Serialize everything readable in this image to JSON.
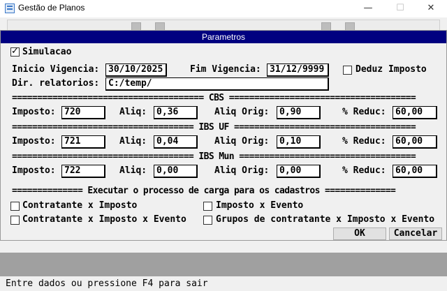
{
  "window": {
    "title": "Gestão de Planos",
    "min_glyph": "—",
    "max_glyph": "☐",
    "close_glyph": "✕"
  },
  "dialog": {
    "title": "Parametros",
    "simulacao": {
      "label": "Simulacao",
      "checked": true
    },
    "inicio_vigencia": {
      "label": "Inicio Vigencia:",
      "value": "30/10/2025"
    },
    "fim_vigencia": {
      "label": "Fim Vigencia:",
      "value": "31/12/9999"
    },
    "deduz_imposto": {
      "label": "Deduz Imposto",
      "checked": false
    },
    "dir_relatorios": {
      "label": "Dir. relatorios:",
      "value": "C:/temp/"
    },
    "sections": [
      {
        "header": "====================================== CBS =====================================",
        "imposto": "720",
        "aliq": "0,36",
        "aliq_orig": "0,90",
        "reduc": "60,00"
      },
      {
        "header": "==================================== IBS UF ====================================",
        "imposto": "721",
        "aliq": "0,04",
        "aliq_orig": "0,10",
        "reduc": "60,00"
      },
      {
        "header": "==================================== IBS Mun ===================================",
        "imposto": "722",
        "aliq": "0,00",
        "aliq_orig": "0,00",
        "reduc": "60,00"
      }
    ],
    "field_labels": {
      "imposto": "Imposto:",
      "aliq": "Aliq:",
      "aliq_orig": "Aliq Orig:",
      "reduc": "% Reduc:"
    },
    "carga_header": "============== Executar o processo de carga para os cadastros ==============",
    "checks": {
      "contratante_imposto": "Contratante x Imposto",
      "imposto_evento": "Imposto x Evento",
      "contratante_imposto_evento": "Contratante x Imposto x Evento",
      "grupos_contratante": "Grupos de contratante x Imposto x Evento"
    },
    "ok_label": "OK",
    "cancel_label": "Cancelar"
  },
  "status": {
    "text": "Entre dados ou pressione F4 para sair"
  }
}
